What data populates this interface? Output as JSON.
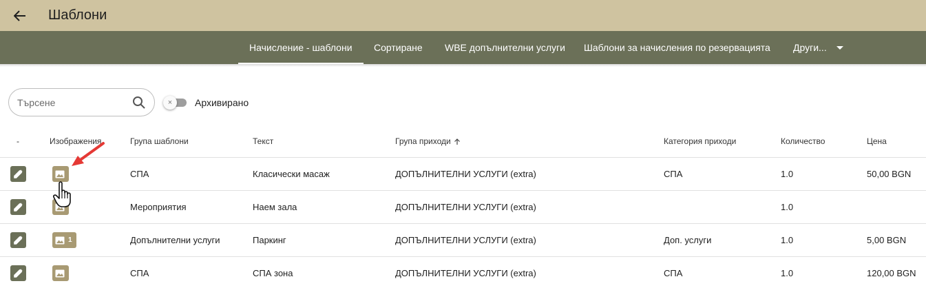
{
  "header": {
    "title": "Шаблони"
  },
  "tabs": [
    {
      "label": "Начисление - шаблони",
      "active": true
    },
    {
      "label": "Сортиране",
      "active": false
    },
    {
      "label": "WBE допълнителни услуги",
      "active": false
    },
    {
      "label": "Шаблони за начисления по резервацията",
      "active": false
    }
  ],
  "tab_more": {
    "label": "Други..."
  },
  "filters": {
    "search_placeholder": "Търсене",
    "archived_label": "Архивирано"
  },
  "table": {
    "columns": [
      "-",
      "Изображения",
      "Група шаблони",
      "Текст",
      "Група приходи",
      "Категория приходи",
      "Количество",
      "Цена"
    ],
    "rows": [
      {
        "image_count": "",
        "group": "СПА",
        "text": "Класически масаж",
        "income_group": "ДОПЪЛНИТЕЛНИ УСЛУГИ (extra)",
        "income_category": "СПА",
        "quantity": "1.0",
        "price": "50,00 BGN"
      },
      {
        "image_count": "",
        "group": "Мероприятия",
        "text": "Наем зала",
        "income_group": "ДОПЪЛНИТЕЛНИ УСЛУГИ (extra)",
        "income_category": "",
        "quantity": "1.0",
        "price": ""
      },
      {
        "image_count": "1",
        "group": "Допълнителни услуги",
        "text": "Паркинг",
        "income_group": "ДОПЪЛНИТЕЛНИ УСЛУГИ (extra)",
        "income_category": "Доп. услуги",
        "quantity": "1.0",
        "price": "5,00 BGN"
      },
      {
        "image_count": "",
        "group": "СПА",
        "text": "СПА зона",
        "income_group": "ДОПЪЛНИТЕЛНИ УСЛУГИ (extra)",
        "income_category": "СПА",
        "quantity": "1.0",
        "price": "120,00 BGN"
      }
    ]
  },
  "colors": {
    "topbar": "#cfc3a0",
    "tabbar": "#6b7058",
    "edit_button": "#6b7058",
    "image_button": "#a89a73",
    "annotation_arrow": "#e53935"
  }
}
